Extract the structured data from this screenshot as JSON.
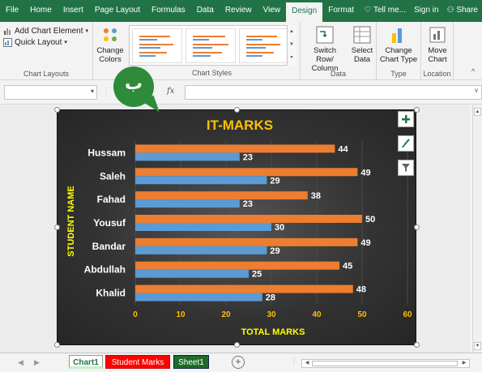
{
  "tabs": [
    "File",
    "Home",
    "Insert",
    "Page Layout",
    "Formulas",
    "Data",
    "Review",
    "View",
    "Design",
    "Format"
  ],
  "active_tab": "Design",
  "tell_me": "Tell me...",
  "sign_in": "Sign in",
  "share": "Share",
  "ribbon": {
    "add_chart_element": "Add Chart Element",
    "quick_layout": "Quick Layout",
    "change_colors": "Change Colors",
    "chart_layouts_label": "Chart Layouts",
    "chart_styles_label": "Chart Styles",
    "switch_row_column": "Switch Row/ Column",
    "select_data": "Select Data",
    "data_label": "Data",
    "change_chart_type": "Change Chart Type",
    "type_label": "Type",
    "move_chart": "Move Chart",
    "location_label": "Location"
  },
  "formula_bar": {
    "fx": "fx",
    "name_box": "",
    "formula": ""
  },
  "annotation_badge": "ب",
  "sheets": [
    {
      "name": "Chart1",
      "active": true,
      "color": "#c6efce"
    },
    {
      "name": "Student Marks",
      "active": false,
      "color": "#ff0000"
    },
    {
      "name": "Sheet1",
      "active": false,
      "color": "#1e6b2a"
    }
  ],
  "colors": {
    "ribbon_green": "#217346",
    "series_orange": "#ed7d31",
    "series_blue": "#5b9bd5",
    "title_yellow": "#ffc000",
    "axis_yellow": "#ffff00"
  },
  "chart_data": {
    "type": "bar",
    "title": "IT-MARKS",
    "xlabel": "TOTAL MARKS",
    "ylabel": "STUDENT NAME",
    "categories": [
      "Hussam",
      "Saleh",
      "Fahad",
      "Yousuf",
      "Bandar",
      "Abdullah",
      "Khalid"
    ],
    "series": [
      {
        "values": [
          44,
          49,
          38,
          50,
          49,
          45,
          48
        ],
        "color": "#ed7d31"
      },
      {
        "values": [
          23,
          29,
          23,
          30,
          29,
          25,
          28
        ],
        "color": "#5b9bd5"
      }
    ],
    "xlim": [
      0,
      60
    ],
    "xticks": [
      "0",
      "10",
      "20",
      "30",
      "40",
      "50",
      "60"
    ],
    "grid": true,
    "legend": "none"
  }
}
